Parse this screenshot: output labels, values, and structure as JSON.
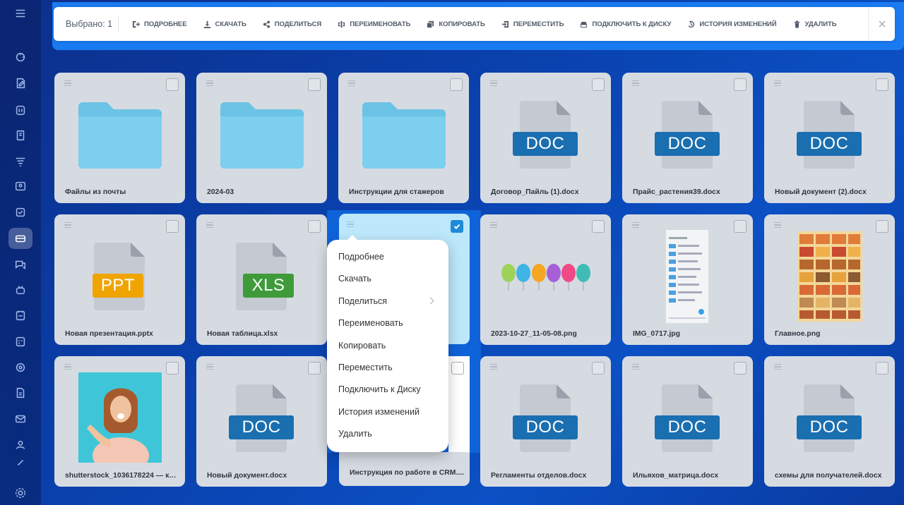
{
  "toolbar": {
    "selected": "Выбрано: 1",
    "buttons": [
      {
        "label": "Подробнее",
        "icon": "details-icon"
      },
      {
        "label": "Скачать",
        "icon": "download-icon"
      },
      {
        "label": "Поделиться",
        "icon": "share-icon"
      },
      {
        "label": "Переименовать",
        "icon": "rename-icon"
      },
      {
        "label": "Копировать",
        "icon": "copy-icon"
      },
      {
        "label": "Переместить",
        "icon": "move-icon"
      },
      {
        "label": "Подключить к диску",
        "icon": "connect-disk-icon"
      },
      {
        "label": "История изменений",
        "icon": "history-icon"
      },
      {
        "label": "Удалить",
        "icon": "trash-icon"
      }
    ]
  },
  "files": [
    {
      "name": "Файлы из почты",
      "type": "folder"
    },
    {
      "name": "2024-03",
      "type": "folder"
    },
    {
      "name": "Инструкции для стажеров",
      "type": "folder"
    },
    {
      "name": "Договор_Пайль (1).docx",
      "type": "doc",
      "badge": "DOC"
    },
    {
      "name": "Прайс_растения39.docx",
      "type": "doc",
      "badge": "DOC"
    },
    {
      "name": "Новый документ (2).docx",
      "type": "doc",
      "badge": "DOC"
    },
    {
      "name": "Новая презентация.pptx",
      "type": "doc",
      "badge": "PPT"
    },
    {
      "name": "Новая таблица.xlsx",
      "type": "doc",
      "badge": "XLS"
    },
    {
      "name": "",
      "type": "selected"
    },
    {
      "name": "2023-10-27_11-05-08.png",
      "type": "image-balloons"
    },
    {
      "name": "IMG_0717.jpg",
      "type": "image-phone"
    },
    {
      "name": "Главное.png",
      "type": "image-collage"
    },
    {
      "name": "shutterstock_1036178224 — коп...",
      "type": "image-photo"
    },
    {
      "name": "Новый документ.docx",
      "type": "doc",
      "badge": "DOC"
    },
    {
      "name": "Инструкция по работе в CRM....",
      "type": "hidden"
    },
    {
      "name": "Регламенты отделов.docx",
      "type": "doc",
      "badge": "DOC"
    },
    {
      "name": "Ильяхов_матрица.docx",
      "type": "doc",
      "badge": "DOC"
    },
    {
      "name": "схемы для получателей.docx",
      "type": "doc",
      "badge": "DOC"
    }
  ],
  "context_menu": {
    "items": [
      "Подробнее",
      "Скачать",
      "Поделиться",
      "Переименовать",
      "Копировать",
      "Переместить",
      "Подключить к Диску",
      "История изменений",
      "Удалить"
    ]
  },
  "colors": {
    "doc": "#1a6fb0",
    "ppt": "#f0a400",
    "xls": "#3f9b3a",
    "folder": "#6bc3e6",
    "accent": "#1a7af0"
  }
}
